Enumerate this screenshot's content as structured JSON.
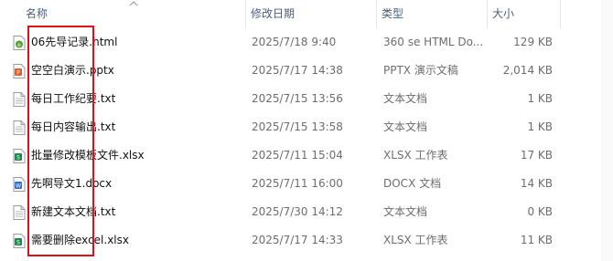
{
  "columns": {
    "name": "名称",
    "date": "修改日期",
    "type": "类型",
    "size": "大小"
  },
  "sort_icon": "chevron-up-icon",
  "files": [
    {
      "name": "06先导记录.html",
      "date": "2025/7/18 9:40",
      "type": "360 se HTML Do...",
      "size": "129 KB",
      "icon": "html-file-icon",
      "color": "#3b8c2a"
    },
    {
      "name": "空空白演示.pptx",
      "date": "2025/7/17 14:38",
      "type": "PPTX 演示文稿",
      "size": "2,014 KB",
      "icon": "pptx-file-icon",
      "color": "#d9622b"
    },
    {
      "name": "每日工作纪要.txt",
      "date": "2025/7/15 13:56",
      "type": "文本文档",
      "size": "1 KB",
      "icon": "txt-file-icon",
      "color": "#8a8a8a"
    },
    {
      "name": "每日内容输出.txt",
      "date": "2025/7/15 13:58",
      "type": "文本文档",
      "size": "1 KB",
      "icon": "txt-file-icon",
      "color": "#8a8a8a"
    },
    {
      "name": "批量修改模板文件.xlsx",
      "date": "2025/7/11 15:04",
      "type": "XLSX 工作表",
      "size": "17 KB",
      "icon": "xlsx-file-icon",
      "color": "#1f8a4c"
    },
    {
      "name": "先啊导文1.docx",
      "date": "2025/7/11 16:00",
      "type": "DOCX 文档",
      "size": "14 KB",
      "icon": "docx-file-icon",
      "color": "#2f6fd6"
    },
    {
      "name": "新建文本文档.txt",
      "date": "2025/7/30 14:12",
      "type": "文本文档",
      "size": "0 KB",
      "icon": "txt-file-icon",
      "color": "#8a8a8a"
    },
    {
      "name": "需要删除excel.xlsx",
      "date": "2025/7/17 14:33",
      "type": "XLSX 工作表",
      "size": "11 KB",
      "icon": "xlsx-file-icon",
      "color": "#1f8a4c"
    }
  ],
  "highlight_color": "#e0101a"
}
